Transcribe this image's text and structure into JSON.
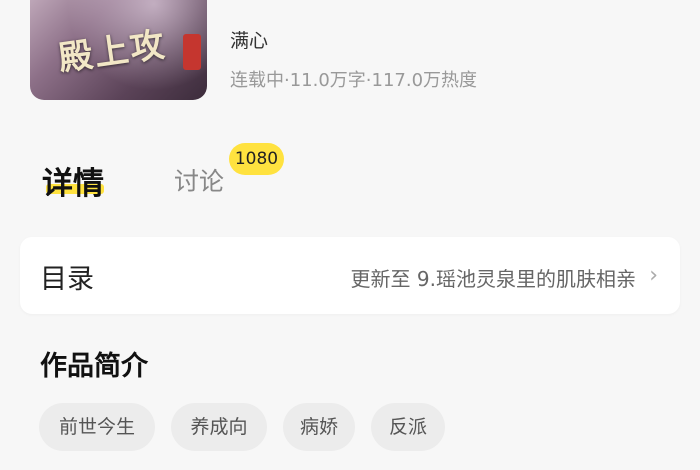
{
  "book": {
    "cover_title": "殿上攻",
    "author": "满心",
    "meta": "连载中·11.0万字·117.0万热度"
  },
  "tabs": {
    "detail_label": "详情",
    "discuss_label": "讨论",
    "discuss_count": "1080"
  },
  "catalog": {
    "title": "目录",
    "latest": "更新至 9.瑶池灵泉里的肌肤相亲",
    "chevron": "›"
  },
  "intro": {
    "title": "作品简介",
    "tags": [
      "前世今生",
      "养成向",
      "病娇",
      "反派"
    ]
  },
  "colors": {
    "accent": "#ffe23f",
    "background": "#f7f7f7"
  }
}
